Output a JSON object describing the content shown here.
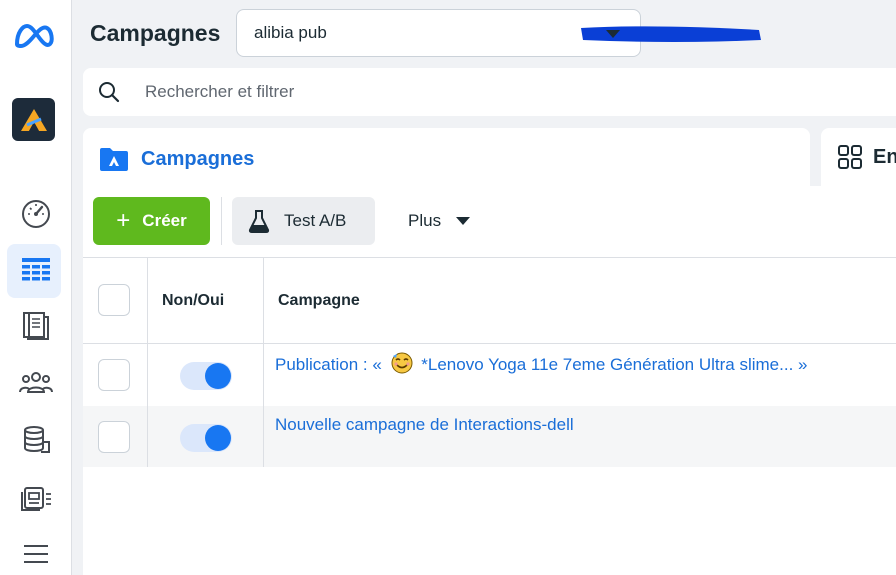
{
  "header": {
    "title": "Campagnes",
    "account_value": "alibia pub"
  },
  "search": {
    "placeholder": "Rechercher et filtrer"
  },
  "tabs": [
    {
      "label": "Campagnes",
      "active": true
    },
    {
      "label": "En",
      "active": false
    }
  ],
  "toolbar": {
    "create_label": "Créer",
    "create_plus": "+",
    "ab_test_label": "Test A/B",
    "more_label": "Plus"
  },
  "table": {
    "columns": [
      "Non/Oui",
      "Campagne"
    ],
    "rows": [
      {
        "campaign_prefix": "Publication : «",
        "campaign_text": "*Lenovo Yoga 11e 7eme Génération Ultra slime... »",
        "enabled": true
      },
      {
        "campaign_prefix": "",
        "campaign_text": "Nouvelle campagne de Interactions-dell",
        "enabled": true
      }
    ]
  },
  "colors": {
    "accent": "#1877f2",
    "create_green": "#5fb91e",
    "link_blue": "#1a6ed8",
    "active_rail_bg": "#e7f0fd"
  },
  "icons": {
    "logo": "meta-logo",
    "account": "account-avatar",
    "rail": [
      "dashboard-gauge-icon",
      "campaigns-table-icon",
      "pages-icon",
      "audiences-icon",
      "billing-stack-icon",
      "ads-library-icon",
      "menu-icon"
    ]
  }
}
